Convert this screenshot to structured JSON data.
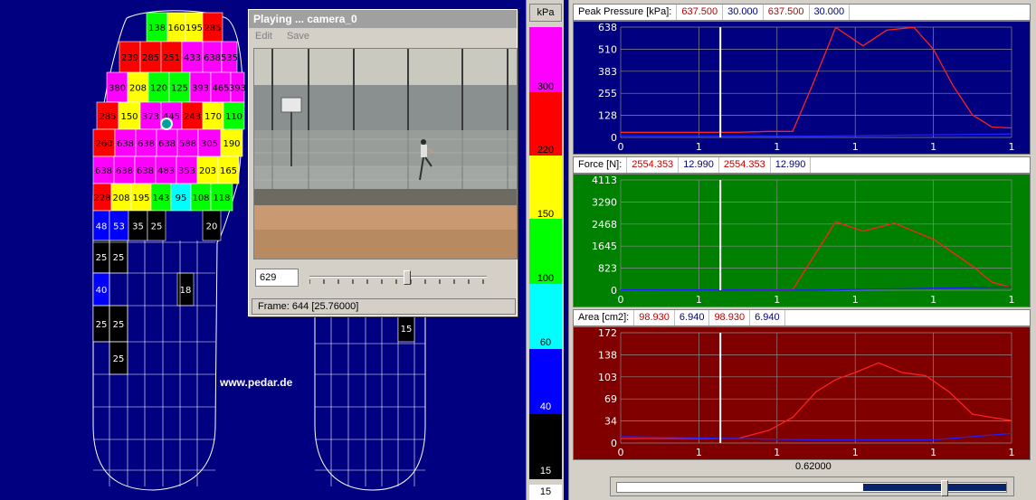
{
  "colors": {
    "background": "#000080",
    "pressure_panel": "#000080",
    "force_panel": "#008000",
    "area_panel": "#800000",
    "curve_left": "#ff2020",
    "curve_right": "#2020ff"
  },
  "foot_left": {
    "rows": [
      [
        "138",
        "160",
        "195",
        "285"
      ],
      [
        "239",
        "285",
        "251",
        "433",
        "638",
        "535"
      ],
      [
        "380",
        "208",
        "120",
        "125",
        "393",
        "465",
        "393"
      ],
      [
        "285",
        "150",
        "373",
        "445",
        "243",
        "170",
        "110"
      ],
      [
        "260",
        "638",
        "638",
        "638",
        "588",
        "305",
        "190"
      ],
      [
        "638",
        "638",
        "638",
        "483",
        "353",
        "203",
        "165"
      ],
      [
        "228",
        "208",
        "195",
        "143",
        "95",
        "108",
        "118"
      ],
      [
        "48",
        "53",
        "35",
        "25",
        "20"
      ],
      [
        "25",
        "25"
      ],
      [
        "40",
        "18"
      ],
      [
        "25",
        "25"
      ],
      [
        "25"
      ]
    ]
  },
  "foot_right": {
    "rows": [
      [
        "15"
      ]
    ]
  },
  "watermark": "www.pedar.de",
  "video": {
    "title": "Playing ...  camera_0",
    "menu": [
      "Edit",
      "Save"
    ],
    "frame_value": "629",
    "status_label": "Frame:",
    "status_value": "644 [25.76000]",
    "slider_position": 0.55
  },
  "legend": {
    "unit": "kPa",
    "labels": [
      "300",
      "220",
      "150",
      "100",
      "60",
      "40",
      "15"
    ],
    "footer": "15"
  },
  "panels": [
    {
      "title": "Peak Pressure  [kPa]:",
      "values": [
        "637.500",
        "30.000",
        "637.500",
        "30.000"
      ],
      "y_ticks": [
        "638",
        "510",
        "383",
        "255",
        "128",
        "0"
      ]
    },
    {
      "title": "Force [N]:",
      "values": [
        "2554.353",
        "12.990",
        "2554.353",
        "12.990"
      ],
      "y_ticks": [
        "4113",
        "3290",
        "2468",
        "1645",
        "823",
        "0"
      ]
    },
    {
      "title": "Area [cm2]:",
      "values": [
        "98.930",
        "6.940",
        "98.930",
        "6.940"
      ],
      "y_ticks": [
        "172",
        "138",
        "103",
        "69",
        "34",
        "0"
      ]
    }
  ],
  "x_ticks": [
    "0",
    "1",
    "1",
    "1",
    "1",
    "1"
  ],
  "time_readout": "0.62000",
  "time_scroll_position": 0.8,
  "chart_data": [
    {
      "type": "line",
      "title": "Peak Pressure  [kPa]:",
      "ylim": [
        0,
        638
      ],
      "series": [
        {
          "x": [
            0,
            0.1,
            0.2,
            0.3,
            0.38,
            0.44,
            0.49,
            0.55,
            0.62,
            0.68,
            0.75,
            0.8,
            0.85,
            0.9,
            0.95,
            1.0
          ],
          "values": [
            30,
            30,
            30,
            30,
            35,
            35,
            300,
            637,
            530,
            620,
            637,
            510,
            300,
            130,
            60,
            55
          ]
        },
        {
          "x": [
            0,
            0.5,
            1.0
          ],
          "values": [
            10,
            8,
            20
          ]
        }
      ]
    },
    {
      "type": "line",
      "title": "Force [N]:",
      "ylim": [
        0,
        4113
      ],
      "series": [
        {
          "x": [
            0,
            0.2,
            0.38,
            0.44,
            0.5,
            0.55,
            0.62,
            0.7,
            0.8,
            0.9,
            0.95,
            1.0
          ],
          "values": [
            0,
            0,
            10,
            20,
            1400,
            2554,
            2200,
            2500,
            1900,
            900,
            300,
            100
          ]
        },
        {
          "x": [
            0,
            0.5,
            1.0
          ],
          "values": [
            13,
            5,
            120
          ]
        }
      ]
    },
    {
      "type": "line",
      "title": "Area [cm2]:",
      "ylim": [
        0,
        172
      ],
      "series": [
        {
          "x": [
            0,
            0.1,
            0.2,
            0.3,
            0.38,
            0.44,
            0.5,
            0.55,
            0.6,
            0.66,
            0.72,
            0.78,
            0.84,
            0.9,
            0.95,
            1.0
          ],
          "values": [
            7,
            7,
            7,
            7,
            20,
            40,
            80,
            99,
            110,
            125,
            110,
            105,
            80,
            45,
            40,
            35
          ]
        },
        {
          "x": [
            0,
            0.5,
            0.8,
            1.0
          ],
          "values": [
            10,
            5,
            5,
            15
          ]
        }
      ]
    }
  ]
}
